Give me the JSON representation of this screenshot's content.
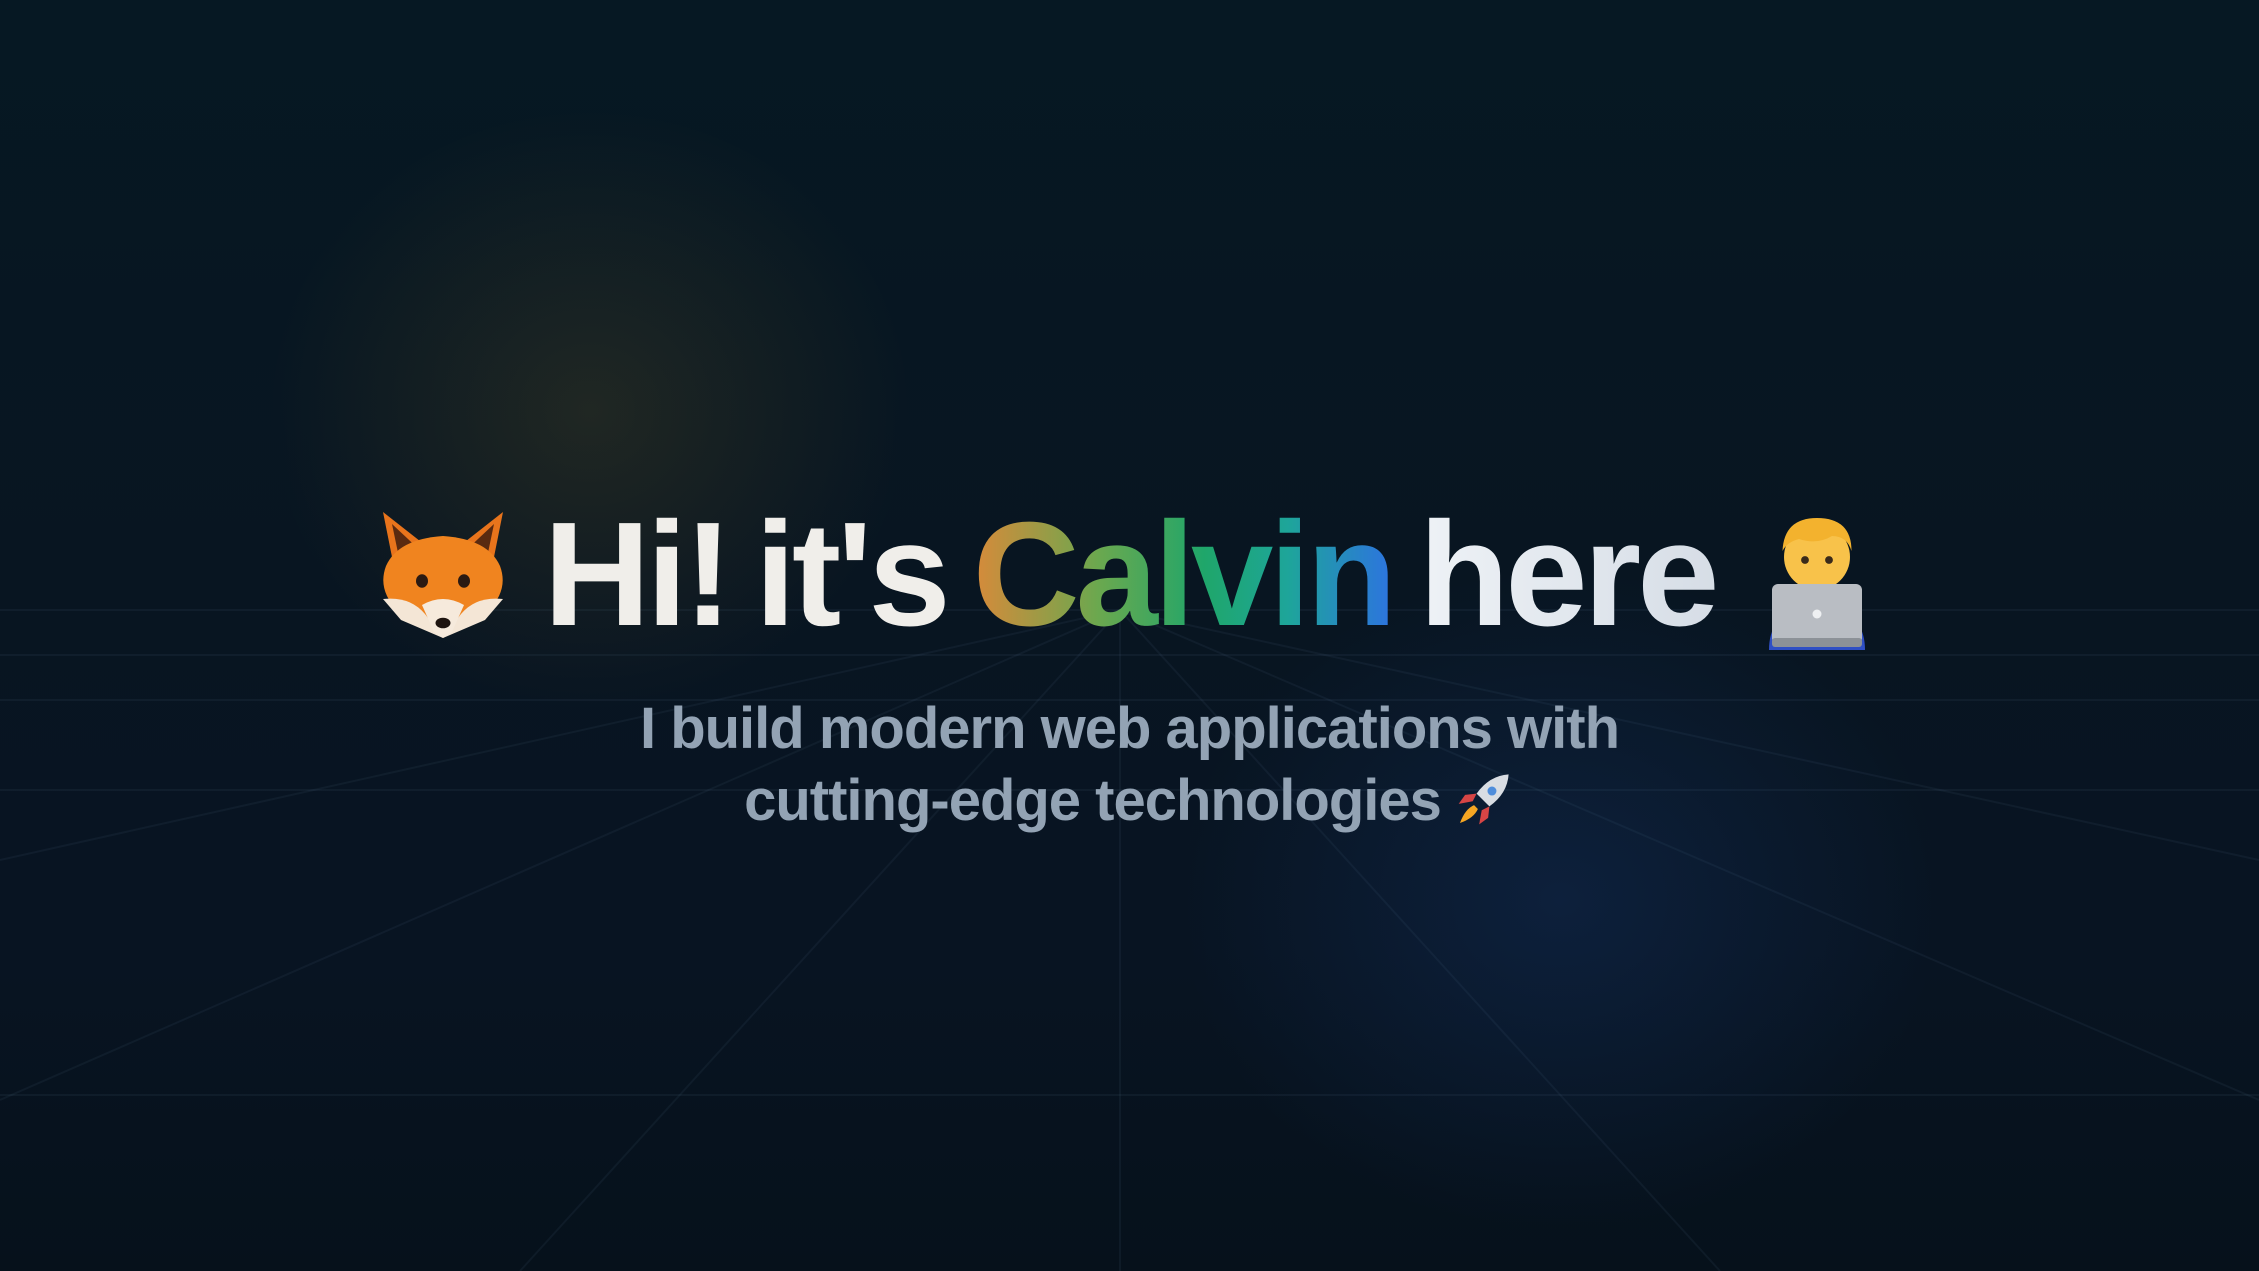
{
  "hero": {
    "greeting": "Hi!",
    "its": "it's",
    "name": "Calvin",
    "here": "here",
    "subtitle_line1": "I build modern web applications with",
    "subtitle_line2": "cutting-edge technologies"
  },
  "icons": {
    "left": "fox-face-icon",
    "right": "technologist-laptop-icon",
    "subtitle": "rocket-icon"
  },
  "colors": {
    "background": "#07141f",
    "headline": "#eef0f2",
    "subtitle": "#93a3b4",
    "name_gradient_start": "#d88a3a",
    "name_gradient_mid": "#1fa66a",
    "name_gradient_end": "#2d73e0"
  }
}
